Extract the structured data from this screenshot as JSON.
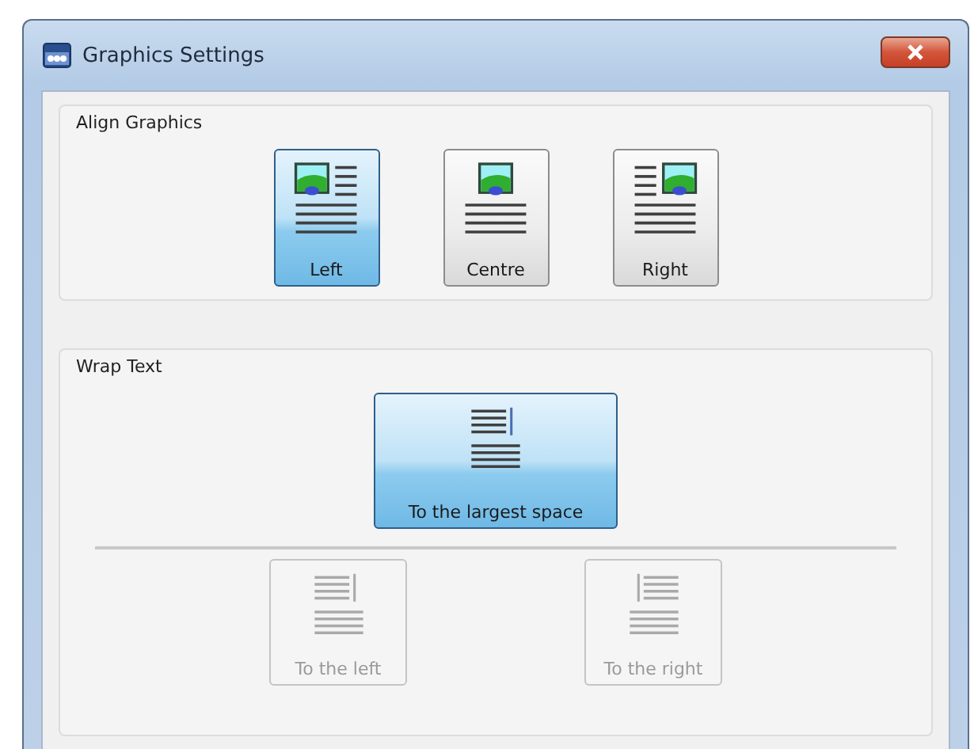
{
  "window": {
    "title": "Graphics Settings"
  },
  "align_graphics": {
    "title": "Align Graphics",
    "options": [
      {
        "label": "Left",
        "kind": "image-left",
        "selected": true
      },
      {
        "label": "Centre",
        "kind": "image-centre",
        "selected": false
      },
      {
        "label": "Right",
        "kind": "image-right",
        "selected": false
      }
    ]
  },
  "wrap_text": {
    "title": "Wrap Text",
    "main_option": {
      "label": "To the largest space",
      "kind": "wrap-largest",
      "selected": true,
      "disabled": false
    },
    "options": [
      {
        "label": "To the left",
        "kind": "wrap-left",
        "selected": false,
        "disabled": true
      },
      {
        "label": "To the right",
        "kind": "wrap-right",
        "selected": false,
        "disabled": true
      }
    ]
  }
}
